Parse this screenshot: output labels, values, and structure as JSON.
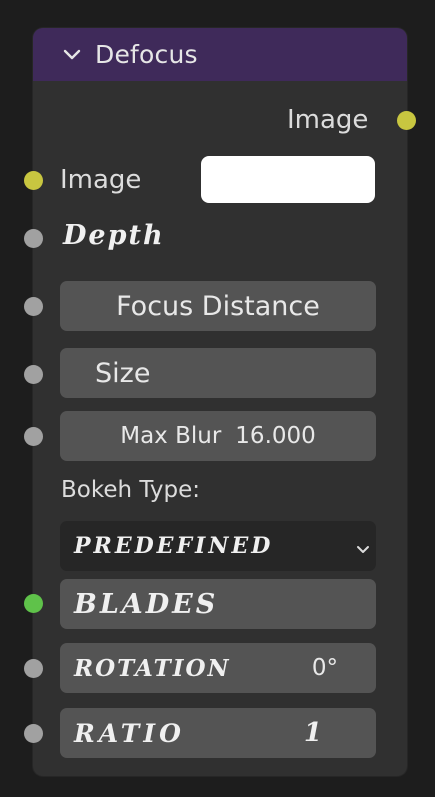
{
  "node": {
    "title": "Defocus",
    "header_color": "#3f2a5a",
    "output_image_label": "Image",
    "input_image_label": "Image",
    "input_image_color": "#ffffff",
    "depth_label": "Depth",
    "focus_distance_label": "Focus Distance",
    "size_label": "Size",
    "max_blur_label": "Max Blur",
    "max_blur_value": "16.000",
    "bokeh_type_label": "Bokeh Type:",
    "bokeh_type_value": "PREDEFINED",
    "blades_label": "BLADES",
    "rotation_label": "ROTATION",
    "rotation_value": "0°",
    "ratio_label": "RATIO",
    "ratio_value": "1"
  },
  "socket_colors": {
    "image": "#c8c640",
    "value": "#a1a1a1",
    "integer": "#5fc24a"
  },
  "icons": {
    "collapse": "chevron-down-icon",
    "dropdown": "chevron-down-icon"
  }
}
